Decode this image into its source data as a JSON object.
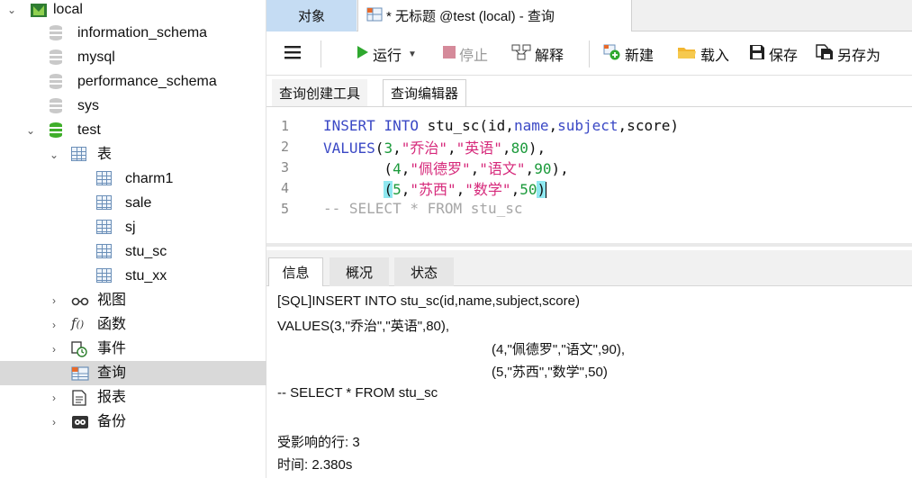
{
  "sidebar": {
    "connection": "local",
    "databases_before": [
      "information_schema",
      "mysql",
      "performance_schema",
      "sys"
    ],
    "active_db": "test",
    "tables_folder": "表",
    "tables": [
      "charm1",
      "sale",
      "sj",
      "stu_sc",
      "stu_xx"
    ],
    "folders": {
      "views": "视图",
      "functions": "函数",
      "events": "事件",
      "queries": "查询",
      "reports": "报表",
      "backups": "备份"
    }
  },
  "tabs": {
    "objects": "对象",
    "query_title": "* 无标题 @test (local) - 查询"
  },
  "toolbar": {
    "run": "运行",
    "stop": "停止",
    "explain": "解释",
    "new": "新建",
    "load": "载入",
    "save": "保存",
    "save_as": "另存为"
  },
  "subtabs": {
    "builder": "查询创建工具",
    "editor": "查询编辑器"
  },
  "editor": {
    "line_numbers": [
      "1",
      "2",
      "3",
      "4",
      "5"
    ],
    "lines": [
      {
        "kw1": "INSERT",
        "kw2": "INTO",
        "plain1": " stu_sc(id,",
        "kw3": "name",
        "plain2": ",",
        "kw4": "subject",
        "plain3": ",score)"
      },
      {
        "kw1": "VALUES",
        "plain1": "(",
        "num1": "3",
        "plain2": ",",
        "str1": "\"乔治\"",
        "plain3": ",",
        "str2": "\"英语\"",
        "plain4": ",",
        "num2": "80",
        "plain5": "),"
      },
      {
        "plain0": "       (",
        "num1": "4",
        "plain2": ",",
        "str1": "\"佩德罗\"",
        "plain3": ",",
        "str2": "\"语文\"",
        "plain4": ",",
        "num2": "90",
        "plain5": "),"
      },
      {
        "plain0": "       ",
        "hlopen": "(",
        "num1": "5",
        "plain2": ",",
        "str1": "\"苏西\"",
        "plain3": ",",
        "str2": "\"数学\"",
        "plain4": ",",
        "num2": "50",
        "hlclose": ")"
      },
      {
        "comment": "-- SELECT * FROM stu_sc"
      }
    ]
  },
  "result_tabs": {
    "info": "信息",
    "overview": "概况",
    "status": "状态"
  },
  "messages": {
    "sql_1": "[SQL]INSERT INTO stu_sc(id,name,subject,score)",
    "sql_2": "VALUES(3,\"乔治\",\"英语\",80),",
    "sql_3": "(4,\"佩德罗\",\"语文\",90),",
    "sql_4": "(5,\"苏西\",\"数学\",50)",
    "sql_5": "-- SELECT * FROM stu_sc",
    "affected": "受影响的行: 3",
    "time": "时间: 2.380s"
  },
  "colors": {
    "accent_tab": "#c5dcf3",
    "db_green": "#3fae2a",
    "keyword": "#3a48c5",
    "string": "#d6287a",
    "number": "#1b9a3b",
    "bracket_highlight": "#8fe8f0"
  }
}
